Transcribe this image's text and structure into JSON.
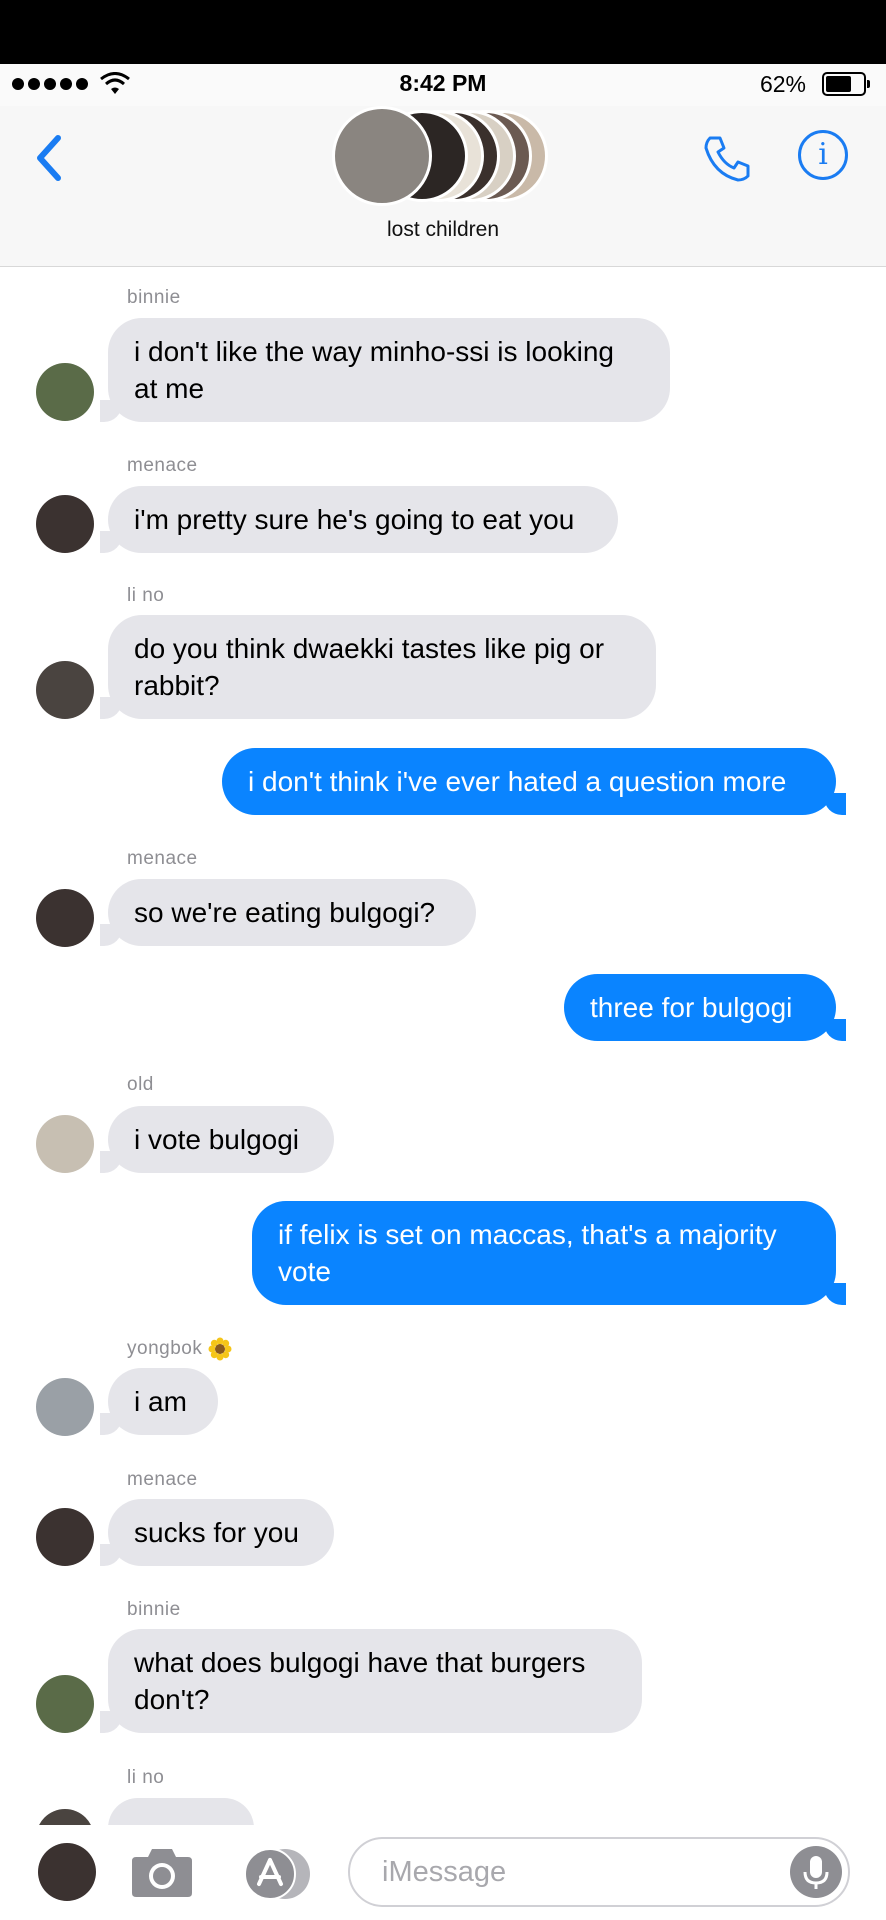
{
  "status_bar": {
    "time": "8:42 PM",
    "battery": "62%"
  },
  "header": {
    "group_name": "lost children"
  },
  "messages": [
    {
      "sender": "binnie",
      "text": "i don't like the way minho-ssi is looking at me"
    },
    {
      "sender": "menace",
      "text": "i'm pretty sure he's going to eat you"
    },
    {
      "sender": "li no",
      "text": "do you think dwaekki tastes like pig or rabbit?"
    },
    {
      "text": "i don't think i've ever hated a question more"
    },
    {
      "sender": "menace",
      "text": "so we're eating bulgogi?"
    },
    {
      "text": "three for bulgogi"
    },
    {
      "sender": "old",
      "text": "i vote bulgogi"
    },
    {
      "text": "if felix is set on maccas, that's a majority vote"
    },
    {
      "sender": "yongbok",
      "text": "i am"
    },
    {
      "sender": "menace",
      "text": "sucks for you"
    },
    {
      "sender": "binnie",
      "text": "what does bulgogi have that burgers don't?"
    },
    {
      "sender": "li no"
    }
  ],
  "composer": {
    "placeholder": "iMessage"
  },
  "colors": {
    "accent": "#0a84ff",
    "incoming_bubble": "#e5e5ea",
    "header_icons": "#1a7cf2"
  }
}
